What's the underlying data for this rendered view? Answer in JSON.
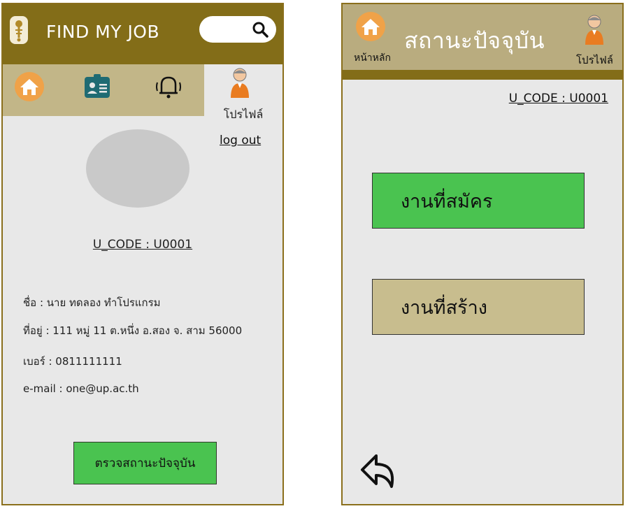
{
  "left_screen": {
    "app_title": "FIND MY JOB",
    "search": {
      "icon": "search-icon"
    },
    "nav": {
      "home_icon": "home-icon",
      "id_card_icon": "id-card-icon",
      "bell_icon": "bell-icon",
      "profile_label": "โปรไฟล์"
    },
    "logout_label": "log out",
    "u_code": "U_CODE : U0001",
    "info": {
      "name": "ชื่อ : นาย ทดลอง ทำโปรแกรม",
      "address": "ที่อยู่ : 111 หมู่ 11 ต.หนึ่ง อ.สอง จ. สาม 56000",
      "phone": "เบอร์ : 0811111111",
      "email": "e-mail : one@up.ac.th"
    },
    "status_button": "ตรวจสถานะปัจจุบัน"
  },
  "right_screen": {
    "home_label": "หน้าหลัก",
    "title": "สถานะปัจจุบัน",
    "profile_label": "โปรไฟล์",
    "u_code": "U_CODE : U0001",
    "applied_jobs_button": "งานที่สมัคร",
    "created_jobs_button": "งานที่สร้าง",
    "back_icon": "back-arrow-icon"
  },
  "colors": {
    "header_brown": "#836d18",
    "nav_tan": "#c2b688",
    "green_button": "#4ac350",
    "tan_button": "#c8bd8e",
    "home_orange": "#f0a248",
    "idcard_teal": "#1f6b73"
  }
}
